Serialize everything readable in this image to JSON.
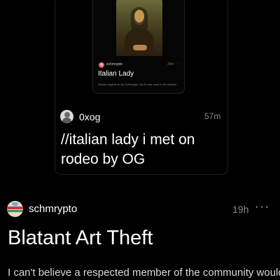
{
  "quoted_post": {
    "author": "0xog",
    "time": "57m",
    "text": "//italian lady i met on rodeo by OG",
    "embedded_post": {
      "author": "schmrypto",
      "time": "39m",
      "more_icon": "more-horizontal-icon",
      "title": "Italian Lady",
      "description": "Wholly original art by Schmrypto. No AI was used in its creation."
    }
  },
  "post": {
    "author": "schmrypto",
    "time": "19h",
    "more_icon": "more-horizontal-icon",
    "title": "Blatant Art Theft",
    "body": "I can't believe a respected member of the community would"
  }
}
